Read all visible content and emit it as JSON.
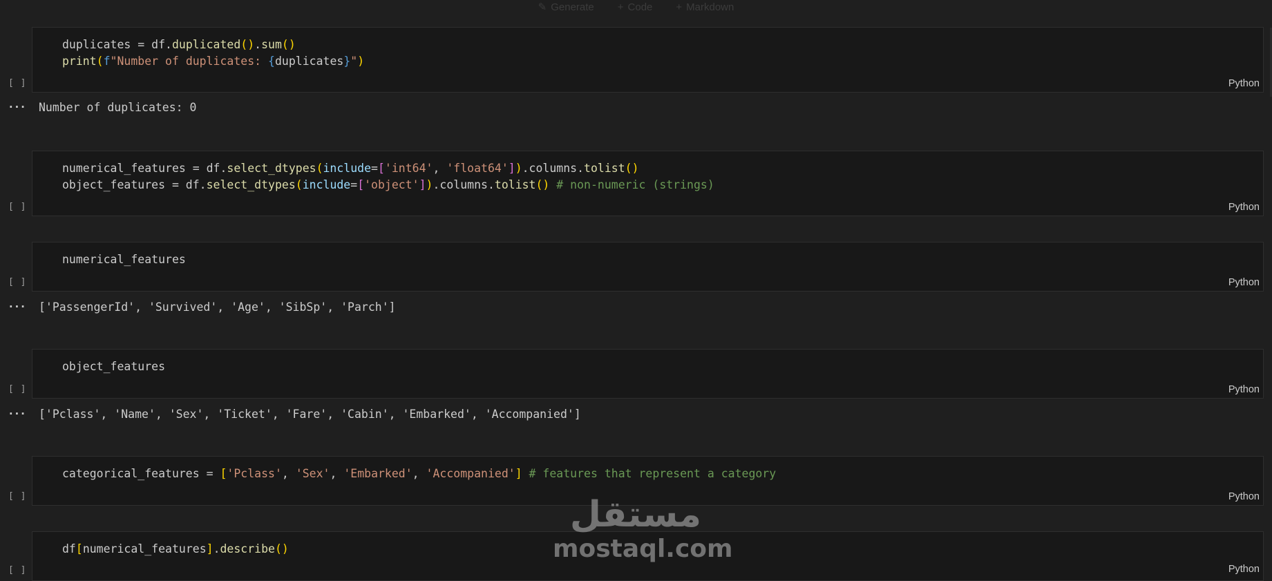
{
  "toolbar": {
    "generate_label": "Generate",
    "code_label": "Code",
    "markdown_label": "Markdown"
  },
  "exec_placeholder": "[ ]",
  "output_dots": "···",
  "language": "Python",
  "cells": [
    {
      "lines": [
        "duplicates = df.duplicated().sum()",
        "print(f\"Number of duplicates: {duplicates}\")"
      ],
      "output": "Number of duplicates: 0"
    },
    {
      "lines": [
        "numerical_features = df.select_dtypes(include=['int64', 'float64']).columns.tolist()",
        "object_features = df.select_dtypes(include=['object']).columns.tolist() # non-numeric (strings)"
      ]
    },
    {
      "lines": [
        "numerical_features"
      ],
      "output": "['PassengerId', 'Survived', 'Age', 'SibSp', 'Parch']"
    },
    {
      "lines": [
        "object_features"
      ],
      "output": "['Pclass', 'Name', 'Sex', 'Ticket', 'Fare', 'Cabin', 'Embarked', 'Accompanied']"
    },
    {
      "lines": [
        "categorical_features = ['Pclass', 'Sex', 'Embarked', 'Accompanied'] # features that represent a category"
      ]
    },
    {
      "lines": [
        "df[numerical_features].describe()"
      ]
    }
  ],
  "watermark": {
    "arabic": "مستقل",
    "latin": "mostaql.com"
  }
}
